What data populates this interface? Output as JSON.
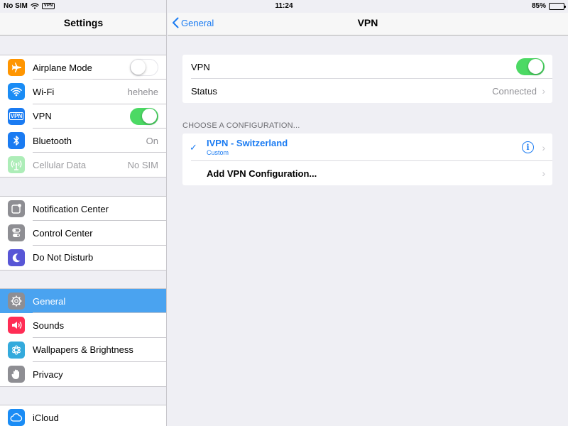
{
  "status_bar": {
    "carrier": "No SIM",
    "vpn_badge": "VPN",
    "time": "11:24",
    "battery": "85%",
    "battery_level": 0.85
  },
  "left_pane": {
    "title": "Settings",
    "groups": [
      [
        {
          "label": "Airplane Mode",
          "icon": "airplane-icon",
          "color": "#ff9500",
          "type": "switch",
          "on": false
        },
        {
          "label": "Wi-Fi",
          "icon": "wifi-icon",
          "color": "#1a8cf5",
          "value": "hehehe"
        },
        {
          "label": "VPN",
          "icon": "vpn-icon",
          "color": "#1a7bf2",
          "type": "switch",
          "on": true
        },
        {
          "label": "Bluetooth",
          "icon": "bluetooth-icon",
          "color": "#1a7bf2",
          "value": "On"
        },
        {
          "label": "Cellular Data",
          "icon": "cellular-icon",
          "color": "#4cd964",
          "value": "No SIM"
        }
      ],
      [
        {
          "label": "Notification Center",
          "icon": "notification-center-icon",
          "color": "#8e8e93"
        },
        {
          "label": "Control Center",
          "icon": "control-center-icon",
          "color": "#8e8e93"
        },
        {
          "label": "Do Not Disturb",
          "icon": "moon-icon",
          "color": "#5856d6"
        }
      ],
      [
        {
          "label": "General",
          "icon": "gear-icon",
          "color": "#8e8e93",
          "selected": true
        },
        {
          "label": "Sounds",
          "icon": "sound-icon",
          "color": "#ff2d55"
        },
        {
          "label": "Wallpapers & Brightness",
          "icon": "wallpaper-icon",
          "color": "#34aadc"
        },
        {
          "label": "Privacy",
          "icon": "privacy-hand-icon",
          "color": "#8e8e93"
        }
      ],
      [
        {
          "label": "iCloud",
          "icon": "cloud-icon",
          "color": "#1a8cf5"
        }
      ]
    ]
  },
  "right_pane": {
    "back_label": "General",
    "title": "VPN",
    "vpn_row": {
      "label": "VPN",
      "on": true
    },
    "status_row": {
      "label": "Status",
      "value": "Connected"
    },
    "section_title": "CHOOSE A CONFIGURATION...",
    "config": {
      "name": "IVPN - Switzerland",
      "type": "Custom"
    },
    "add_config_label": "Add VPN Configuration..."
  }
}
